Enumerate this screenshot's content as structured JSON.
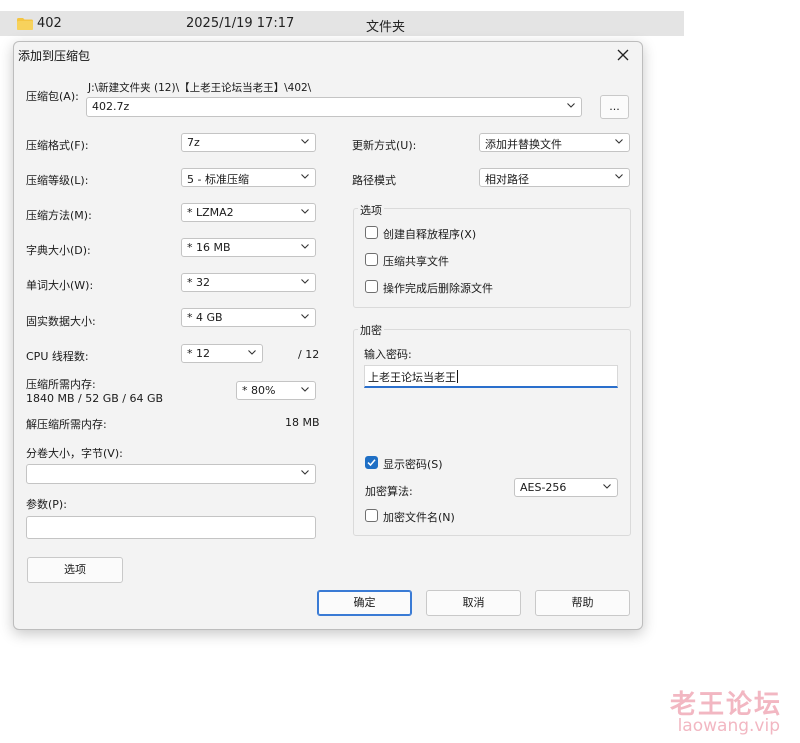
{
  "explorer_row": {
    "name": "402",
    "date": "2025/1/19 17:17",
    "type": "文件夹"
  },
  "dialog": {
    "title": "添加到压缩包",
    "archive_label": "压缩包(A):",
    "archive_path": "J:\\新建文件夹 (12)\\【上老王论坛当老王】\\402\\",
    "archive_name": "402.7z",
    "browse_label": "...",
    "left": {
      "format_label": "压缩格式(F):",
      "format_value": "7z",
      "level_label": "压缩等级(L):",
      "level_value": "5 - 标准压缩",
      "method_label": "压缩方法(M):",
      "method_value": "*  LZMA2",
      "dict_label": "字典大小(D):",
      "dict_value": "*  16 MB",
      "word_label": "单词大小(W):",
      "word_value": "*  32",
      "solid_label": "固实数据大小:",
      "solid_value": "*  4 GB",
      "threads_label": "CPU 线程数:",
      "threads_value": "*  12",
      "threads_max": "/ 12",
      "mem_label": "压缩所需内存:",
      "mem_value_text": "1840 MB / 52 GB / 64 GB",
      "mem_select": "*  80%",
      "decomp_label": "解压缩所需内存:",
      "decomp_value": "18 MB",
      "volume_label": "分卷大小，字节(V):",
      "volume_value": "",
      "params_label": "参数(P):",
      "params_value": ""
    },
    "right": {
      "update_label": "更新方式(U):",
      "update_value": "添加并替换文件",
      "pathmode_label": "路径模式",
      "pathmode_value": "相对路径",
      "options_group": "选项",
      "opt_sfx": "创建自释放程序(X)",
      "opt_shared": "压缩共享文件",
      "opt_delete": "操作完成后删除源文件",
      "encrypt_group": "加密",
      "password_label": "输入密码:",
      "password_value": "上老王论坛当老王",
      "show_password": "显示密码(S)",
      "enc_method_label": "加密算法:",
      "enc_method_value": "AES-256",
      "enc_filenames": "加密文件名(N)"
    },
    "buttons": {
      "options": "选项",
      "ok": "确定",
      "cancel": "取消",
      "help": "帮助"
    }
  },
  "watermark": {
    "cn": "老王论坛",
    "url": "laowang.vip"
  },
  "colors": {
    "accent": "#1f6fc5",
    "folder": "#f4c542",
    "watermark": "#f2b7c2"
  }
}
